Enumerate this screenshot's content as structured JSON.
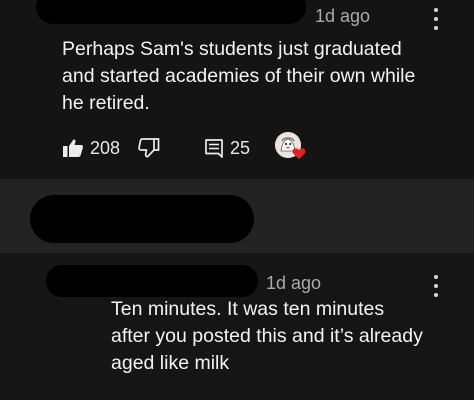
{
  "comments": [
    {
      "time": "1d ago",
      "text_lines": [
        "Perhaps Sam's students just graduated",
        "and started academies of their own while",
        "he retired."
      ],
      "likes": "208",
      "replies": "25"
    },
    {
      "time": "1d ago",
      "text_lines": [
        "Ten minutes. It was ten minutes",
        "after you posted this and it’s already",
        "aged like milk"
      ]
    }
  ],
  "icons": {
    "like": "thumbs-up-icon",
    "dislike": "thumbs-down-icon",
    "replies": "comment-icon",
    "menu": "more-vertical-icon",
    "hearted": "heart-icon"
  },
  "colors": {
    "heart": "#e0202a",
    "meta": "#aaaaaa"
  }
}
